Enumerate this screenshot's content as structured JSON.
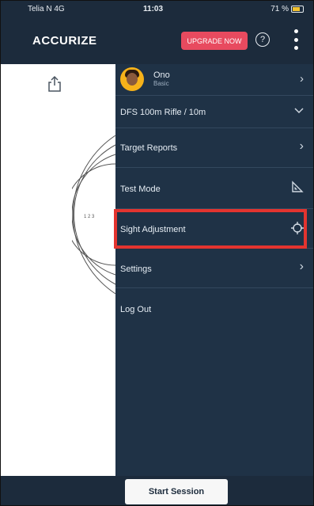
{
  "status_bar": {
    "carrier": "Telia N  4G",
    "time": "11:03",
    "battery": "71 %"
  },
  "header": {
    "logo": "ACCURIZE",
    "upgrade_label": "UPGRADE NOW",
    "help_label": "?"
  },
  "drawer": {
    "user": {
      "name": "Ono",
      "plan": "Basic"
    },
    "discipline": "DFS 100m Rifle / 10m",
    "items": [
      {
        "label": "Target Reports",
        "icon": "chevron-right-icon"
      },
      {
        "label": "Test Mode",
        "icon": "test-mode-icon"
      },
      {
        "label": "Sight Adjustment",
        "icon": "crosshair-icon"
      },
      {
        "label": "Settings",
        "icon": "chevron-right-icon"
      },
      {
        "label": "Log Out"
      }
    ]
  },
  "background": {
    "target_ring_labels": "1 2 3"
  },
  "footer": {
    "start_label": "Start Session"
  },
  "colors": {
    "header_bg": "#1c2b3c",
    "drawer_bg": "#1f3246",
    "upgrade_bg": "#e84a5f",
    "highlight": "#e3342f"
  }
}
